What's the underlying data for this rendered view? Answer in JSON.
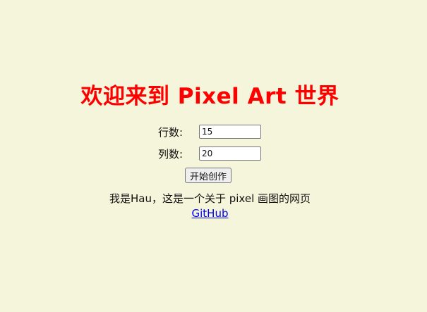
{
  "header": {
    "title": "欢迎来到 Pixel Art 世界"
  },
  "form": {
    "rows_label": "行数:",
    "rows_value": "15",
    "cols_label": "列数:",
    "cols_value": "20",
    "start_button": "开始创作"
  },
  "footer": {
    "about_text": "我是Hau，这是一个关于 pixel 画图的网页",
    "github_link": "GitHub"
  },
  "colors": {
    "background": "#f5f5dc",
    "title": "#ff0000",
    "link": "#0000ee"
  }
}
